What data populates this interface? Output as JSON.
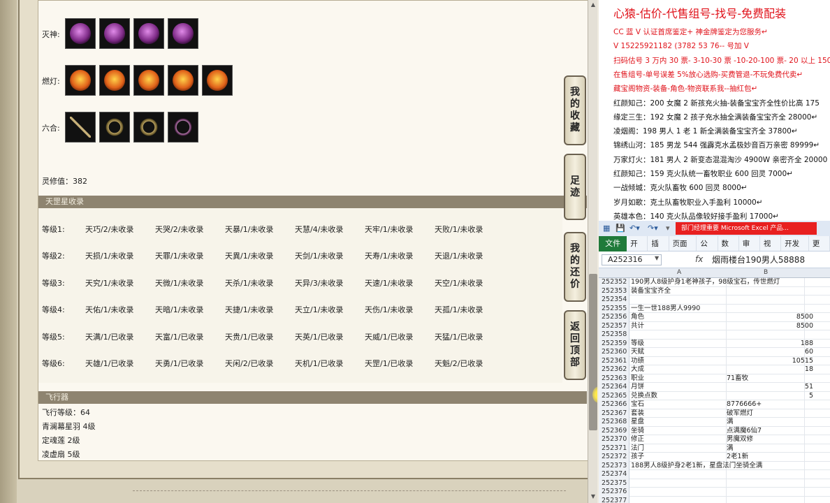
{
  "game": {
    "sets": [
      {
        "label": "灭神:",
        "icons": [
          "purple-armor-icon",
          "purple-helmet-icon",
          "purple-robe-icon",
          "purple-weapon-icon"
        ]
      },
      {
        "label": "燃灯:",
        "icons": [
          "flame-helmet-icon",
          "flame-robe-icon",
          "flame-mask-icon",
          "flame-orb-icon",
          "flame-talisman-icon"
        ]
      },
      {
        "label": "六合:",
        "icons": [
          "chain-necklace-icon",
          "gold-ring-icon",
          "gold-ring-icon",
          "bead-necklace-icon"
        ]
      }
    ],
    "lingxiu": "灵修值：382",
    "tiangang_header": "天罡星收录",
    "tiangang_rows": [
      {
        "level": "等级1:",
        "cells": [
          "天巧/2/未收录",
          "天哭/2/未收录",
          "天暴/1/未收录",
          "天慧/4/未收录",
          "天牢/1/未收录",
          "天败/1/未收录"
        ]
      },
      {
        "level": "等级2:",
        "cells": [
          "天损/1/未收录",
          "天罪/1/未收录",
          "天異/1/未收录",
          "天剑/1/未收录",
          "天寿/1/未收录",
          "天退/1/未收录"
        ]
      },
      {
        "level": "等级3:",
        "cells": [
          "天究/1/未收录",
          "天微/1/未收录",
          "天杀/1/未收录",
          "天异/3/未收录",
          "天速/1/未收录",
          "天空/1/未收录"
        ]
      },
      {
        "level": "等级4:",
        "cells": [
          "天佑/1/未收录",
          "天暗/1/未收录",
          "天捷/1/未收录",
          "天立/1/未收录",
          "天伤/1/未收录",
          "天孤/1/未收录"
        ]
      },
      {
        "level": "等级5:",
        "cells": [
          "天满/1/已收录",
          "天富/1/已收录",
          "天贵/1/已收录",
          "天英/1/已收录",
          "天威/1/已收录",
          "天猛/1/已收录"
        ]
      },
      {
        "level": "等级6:",
        "cells": [
          "天雄/1/已收录",
          "天勇/1/已收录",
          "天闲/2/已收录",
          "天机/1/已收录",
          "天罡/1/已收录",
          "天魁/2/已收录"
        ]
      }
    ],
    "fly_header": "飞行器",
    "fly_lines": [
      "飞行等级：64",
      "青澜幕星羽   4级",
      "定魂莲   2级",
      "凌虚扇   5级"
    ],
    "side_buttons": [
      {
        "chars": [
          "我",
          "的",
          "收",
          "藏"
        ]
      },
      {
        "chars": [
          "足",
          "迹"
        ]
      },
      {
        "chars": [
          "我",
          "的",
          "还",
          "价"
        ]
      },
      {
        "chars": [
          "返",
          "回",
          "顶",
          "部"
        ]
      }
    ]
  },
  "ad": {
    "title": "心猿-估价-代售组号-找号-免费配装",
    "lines": [
      {
        "text": "CC 蓝 V 认证首席鉴定+   神金牌鉴定为您服务↵",
        "color": "red"
      },
      {
        "text": "V 15225921182     (3782   53   76--         号加 V",
        "color": "red"
      },
      {
        "text": "扫码估号 3 万内 30 票- 3-10-30 票  -10-20-100 票- 20 以上 150",
        "color": "red"
      },
      {
        "text": "在售组号-单号误差 5%放心选购-买费管退-不玩免费代卖↵",
        "color": "red"
      },
      {
        "text": "藏宝阁物资-装备-角色-物资联系我--抽红包↵",
        "color": "red"
      },
      {
        "text": "红颜知己：200 女魔 2 新孩充火抽-装备宝宝齐全性价比高 175",
        "color": "blk"
      },
      {
        "text": "缘定三生：192 女魔 2 孩子充水抽全满装备宝宝齐全 28000↵",
        "color": "blk"
      },
      {
        "text": "凌烟阁：198 男人 1 老 1 新全满装备宝宝齐全 37800↵",
        "color": "blk"
      },
      {
        "text": "锦绣山河：185 男龙 544 强霹克水孟极妙音百万亲密 89999↵",
        "color": "blk"
      },
      {
        "text": "万家灯火：181 男人 2 新变态混混淘沙 4900W 亲密齐全 20000",
        "color": "blk"
      },
      {
        "text": "红颜知己：159 克火队统一畜牧职业 600 回灵 7000↵",
        "color": "blk"
      },
      {
        "text": "一战倾城：克火队畜牧 600 回灵 8000↵",
        "color": "blk"
      },
      {
        "text": "岁月如歌：克土队畜牧职业入手盈利 10000↵",
        "color": "blk"
      },
      {
        "text": "英雄本色：140 克火队品像较好接手盈利 17000↵",
        "color": "blk"
      }
    ]
  },
  "excel": {
    "window_tab": "部门经理重要      Microsoft Excel 产品...",
    "ribbon_tabs": [
      "开始",
      "插入",
      "页面布",
      "公式",
      "数据",
      "审阅",
      "视图",
      "开发工",
      "更多"
    ],
    "file_tab": "文件",
    "name_box": "A252316",
    "fx": "fx",
    "formula_value": "烟雨楼台190男人58888",
    "col_a": "A",
    "col_b": "B",
    "rows": [
      {
        "n": "252352",
        "a": "190男人8级护身1老神孩子，98级宝石，传世燃灯",
        "b": "",
        "num": ""
      },
      {
        "n": "252353",
        "a": "装备宝宝齐全",
        "b": "",
        "num": ""
      },
      {
        "n": "252354",
        "a": "",
        "b": "",
        "num": ""
      },
      {
        "n": "252355",
        "a": "一生一世188男人9990",
        "b": "",
        "num": ""
      },
      {
        "n": "252356",
        "a": "角色",
        "b": "",
        "num": "8500"
      },
      {
        "n": "252357",
        "a": "共计",
        "b": "",
        "num": "8500"
      },
      {
        "n": "252358",
        "a": "",
        "b": "",
        "num": ""
      },
      {
        "n": "252359",
        "a": "等级",
        "b": "",
        "num": "188"
      },
      {
        "n": "252360",
        "a": "天赋",
        "b": "",
        "num": "60"
      },
      {
        "n": "252361",
        "a": "功绩",
        "b": "",
        "num": "10515"
      },
      {
        "n": "252362",
        "a": "大成",
        "b": "",
        "num": "18"
      },
      {
        "n": "252363",
        "a": "职业",
        "b": "71畜牧",
        "num": ""
      },
      {
        "n": "252364",
        "a": "月饼",
        "b": "",
        "num": "51"
      },
      {
        "n": "252365",
        "a": "兑换点数",
        "b": "",
        "num": "5"
      },
      {
        "n": "252366",
        "a": "宝石",
        "b": "8776666+",
        "num": ""
      },
      {
        "n": "252367",
        "a": "套装",
        "b": "破军燃灯",
        "num": ""
      },
      {
        "n": "252368",
        "a": "星盘",
        "b": "满",
        "num": ""
      },
      {
        "n": "252369",
        "a": "坐骑",
        "b": "点满魔6仙7",
        "num": ""
      },
      {
        "n": "252370",
        "a": "修正",
        "b": "男魔双修",
        "num": ""
      },
      {
        "n": "252371",
        "a": "法门",
        "b": "满",
        "num": ""
      },
      {
        "n": "252372",
        "a": "孩子",
        "b": "2老1新",
        "num": ""
      },
      {
        "n": "252373",
        "a": "188男人8级护身2老1新，星盘法门坐骑全满",
        "b": "",
        "num": ""
      },
      {
        "n": "252374",
        "a": "",
        "b": "",
        "num": ""
      },
      {
        "n": "252375",
        "a": "",
        "b": "",
        "num": ""
      },
      {
        "n": "252376",
        "a": "",
        "b": "",
        "num": ""
      },
      {
        "n": "252377",
        "a": "",
        "b": "",
        "num": ""
      }
    ]
  },
  "colors": {
    "ad_red": "#e0121a",
    "excel_green": "#1f7a3a",
    "section_head": "#8e8470"
  }
}
